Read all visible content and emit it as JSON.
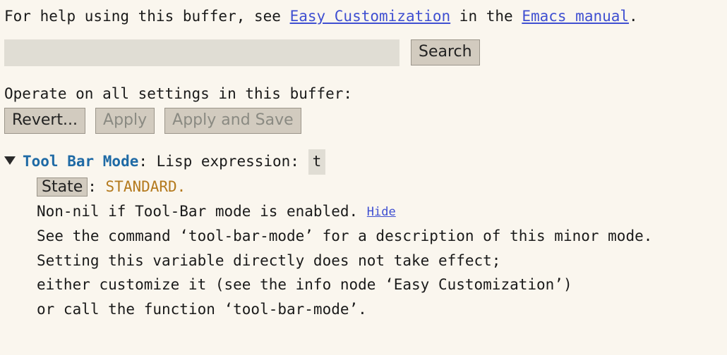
{
  "intro": {
    "prefix": "For help using this buffer, see ",
    "link1": "Easy Customization",
    "mid": " in the ",
    "link2": "Emacs manual",
    "suffix": "."
  },
  "search": {
    "value": "",
    "button": "Search"
  },
  "operate_label": "Operate on all settings in this buffer:",
  "buttons": {
    "revert": "Revert...",
    "apply": "Apply",
    "apply_save": "Apply and Save"
  },
  "variable": {
    "name": "Tool Bar Mode",
    "type_label": ": Lisp expression: ",
    "value": "t",
    "state_btn": "State",
    "state_sep": ": ",
    "state_value": "STANDARD.",
    "doc_first": "Non-nil if Tool-Bar mode is enabled. ",
    "hide": "Hide",
    "doc_lines": [
      "See the command ‘tool-bar-mode’ for a description of this minor mode.",
      "Setting this variable directly does not take effect;",
      "either customize it (see the info node ‘Easy Customization’)",
      "or call the function ‘tool-bar-mode’."
    ]
  }
}
